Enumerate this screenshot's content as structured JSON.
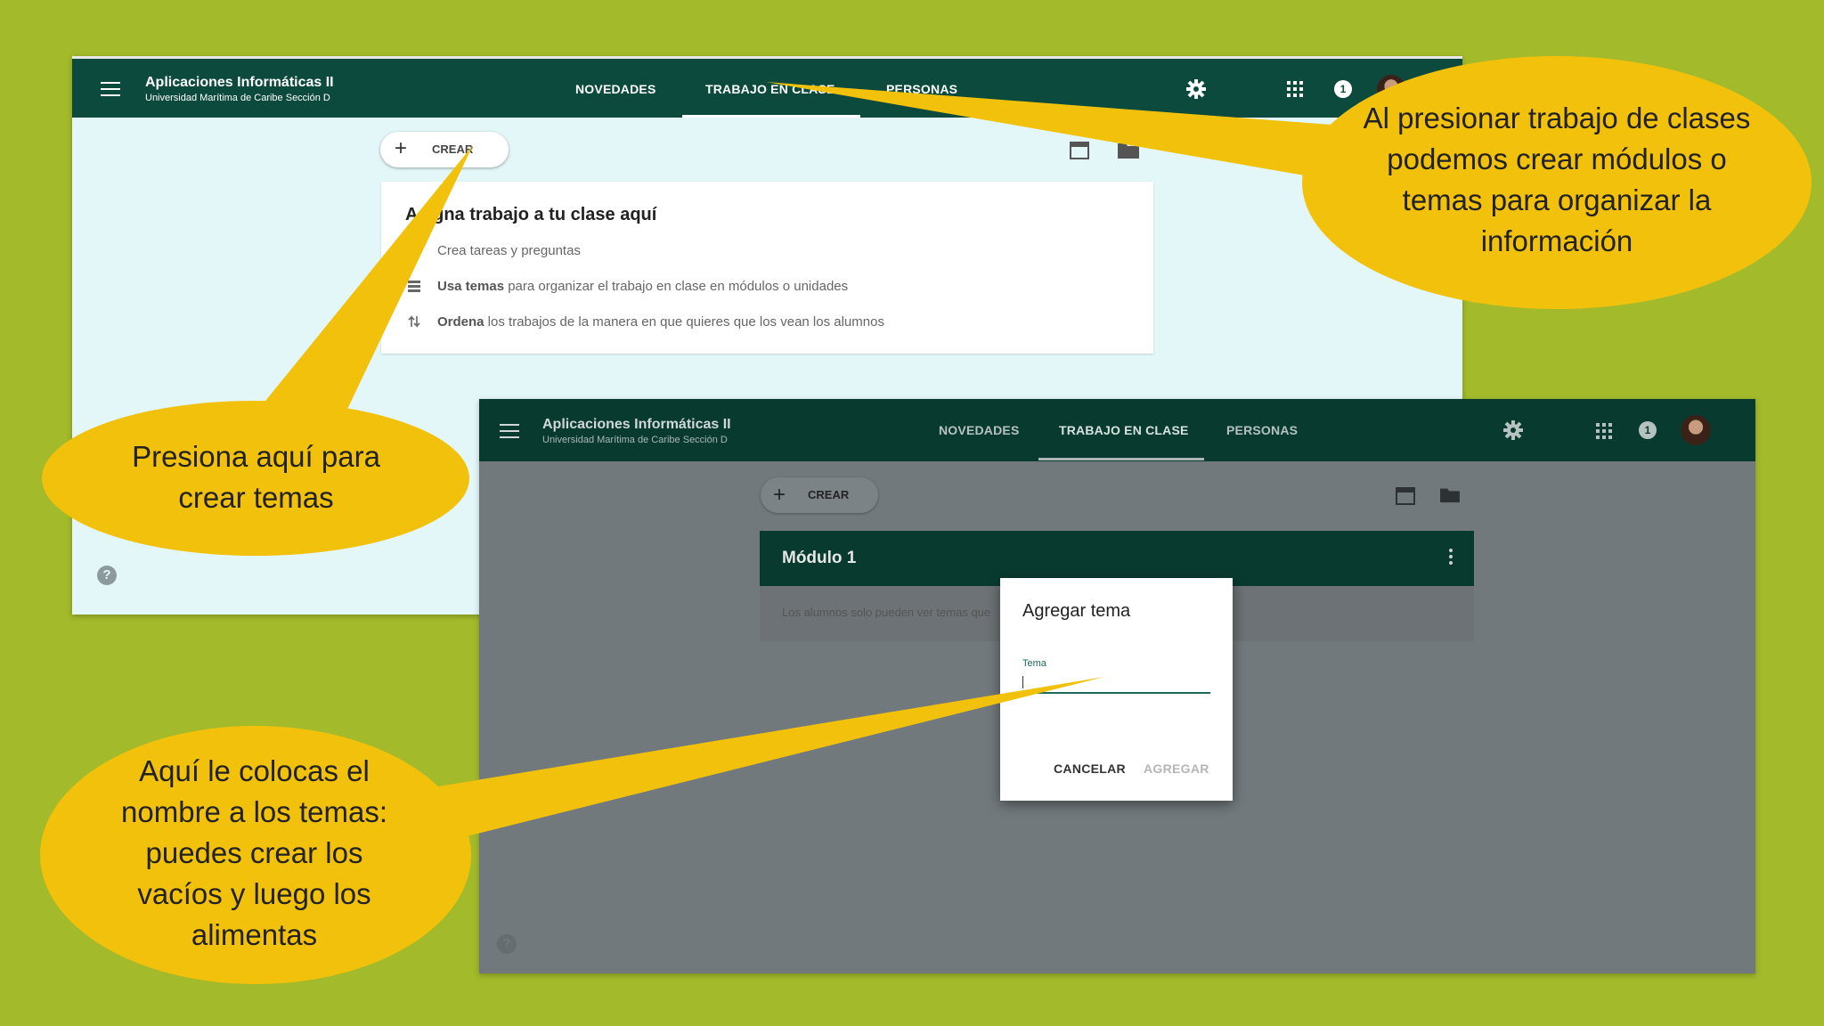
{
  "colors": {
    "slide_background": "#a3ba2b",
    "topbar": "#0b4a3c",
    "callout": "#f2c10b"
  },
  "screenshot1": {
    "app_title": "Aplicaciones Informáticas II",
    "app_subtitle": "Universidad Marítima de Caribe Sección D",
    "tabs": [
      "NOVEDADES",
      "TRABAJO EN CLASE",
      "PERSONAS"
    ],
    "active_tab": "TRABAJO EN CLASE",
    "notification_count": "1",
    "crear_label": "CREAR",
    "card": {
      "title": "Asigna trabajo a tu clase aquí",
      "rows": [
        {
          "bold": "",
          "text": "Crea tareas y preguntas",
          "icon": "assignment-icon"
        },
        {
          "bold": "Usa temas",
          "text": " para organizar el trabajo en clase en módulos o unidades",
          "icon": "topics-list-icon"
        },
        {
          "bold": "Ordena",
          "text": " los trabajos de la manera en que quieres que los vean los alumnos",
          "icon": "reorder-icon"
        }
      ]
    }
  },
  "screenshot2": {
    "app_title": "Aplicaciones Informáticas II",
    "app_subtitle": "Universidad Marítima de Caribe Sección D",
    "tabs": [
      "NOVEDADES",
      "TRABAJO EN CLASE",
      "PERSONAS"
    ],
    "active_tab": "TRABAJO EN CLASE",
    "notification_count": "1",
    "crear_label": "CREAR",
    "module_title": "Módulo 1",
    "module_body": "Los alumnos solo pueden ver temas que",
    "dialog": {
      "title": "Agregar tema",
      "field_label": "Tema",
      "field_value": "",
      "cancel_label": "CANCELAR",
      "add_label": "AGREGAR"
    }
  },
  "callouts": {
    "top_right": "Al presionar trabajo de clases podemos crear módulos o temas para organizar la información",
    "left_middle": "Presiona aquí para crear temas",
    "left_bottom": "Aquí le colocas el nombre a los temas: puedes crear los vacíos y luego los alimentas"
  }
}
